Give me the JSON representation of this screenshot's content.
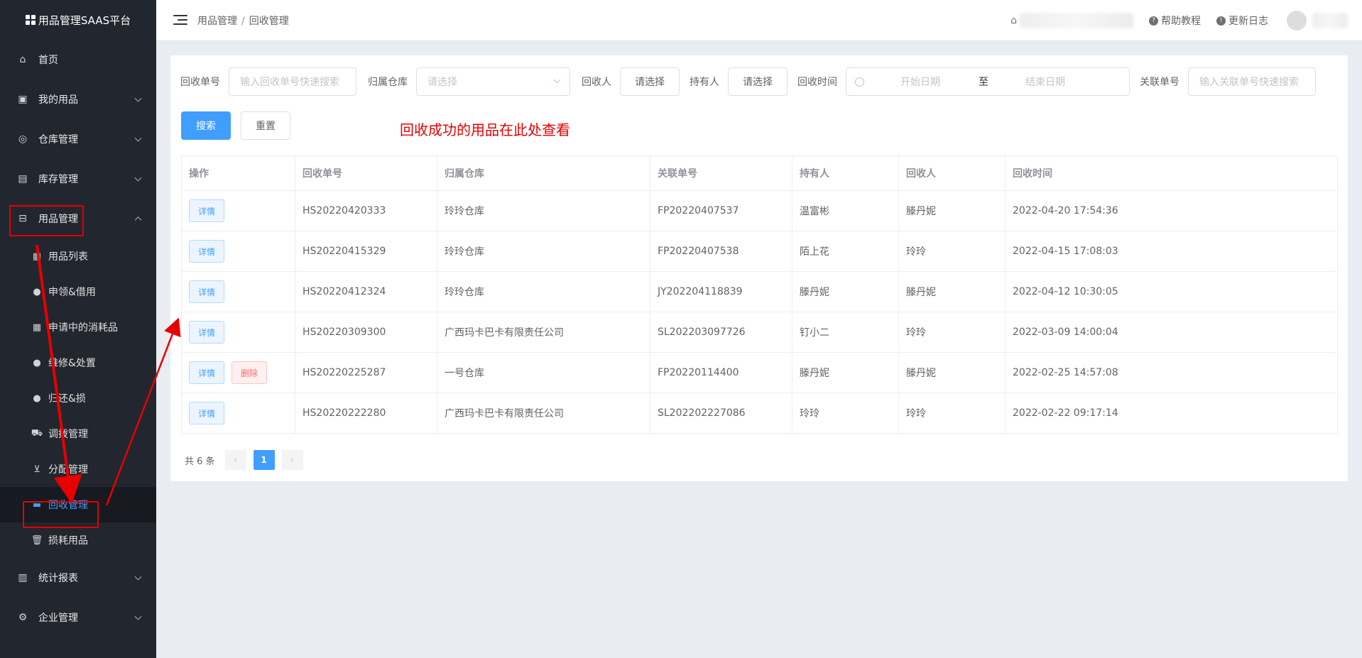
{
  "app": {
    "title": "用品管理SAAS平台"
  },
  "sidebar": {
    "items": [
      {
        "label": "首页",
        "icon": "home-icon"
      },
      {
        "label": "我的用品",
        "icon": "bag-icon"
      },
      {
        "label": "仓库管理",
        "icon": "database-icon"
      },
      {
        "label": "库存管理",
        "icon": "briefcase-icon"
      },
      {
        "label": "用品管理",
        "icon": "inbox-icon"
      }
    ],
    "submenu": [
      {
        "label": "用品列表",
        "icon": "clipboard-icon"
      },
      {
        "label": "申领&借用",
        "icon": "user-icon"
      },
      {
        "label": "申请中的消耗品",
        "icon": "clipboard-icon"
      },
      {
        "label": "维修&处置",
        "icon": "user-icon"
      },
      {
        "label": "归还&损",
        "icon": "user-icon"
      },
      {
        "label": "调拨管理",
        "icon": "truck-icon"
      },
      {
        "label": "分配管理",
        "icon": "cart-icon"
      },
      {
        "label": "回收管理",
        "icon": "recycle-icon"
      },
      {
        "label": "损耗用品",
        "icon": "trash-icon"
      }
    ],
    "bottom": [
      {
        "label": "统计报表",
        "icon": "bar-chart-icon"
      },
      {
        "label": "企业管理",
        "icon": "gear-icon"
      }
    ]
  },
  "header": {
    "breadcrumb": [
      "用品管理",
      "回收管理"
    ],
    "help": "帮助教程",
    "changelog": "更新日志"
  },
  "filters": {
    "recycle_no_label": "回收单号",
    "recycle_no_placeholder": "输入回收单号快速搜索",
    "warehouse_label": "归属仓库",
    "warehouse_placeholder": "请选择",
    "recycler_label": "回收人",
    "recycler_btn": "请选择",
    "holder_label": "持有人",
    "holder_btn": "请选择",
    "time_label": "回收时间",
    "start_placeholder": "开始日期",
    "to": "至",
    "end_placeholder": "结束日期",
    "related_label": "关联单号",
    "related_placeholder": "输入关联单号快速搜索"
  },
  "actions": {
    "search": "搜索",
    "reset": "重置"
  },
  "hint": "回收成功的用品在此处查看",
  "table": {
    "headers": [
      "操作",
      "回收单号",
      "归属仓库",
      "关联单号",
      "持有人",
      "回收人",
      "回收时间"
    ],
    "detail_label": "详情",
    "delete_label": "删除",
    "rows": [
      {
        "no": "HS20220420333",
        "warehouse": "玲玲仓库",
        "related": "FP20220407537",
        "holder": "温富彬",
        "recycler": "滕丹妮",
        "time": "2022-04-20 17:54:36",
        "deletable": false
      },
      {
        "no": "HS20220415329",
        "warehouse": "玲玲仓库",
        "related": "FP20220407538",
        "holder": "陌上花",
        "recycler": "玲玲",
        "time": "2022-04-15 17:08:03",
        "deletable": false
      },
      {
        "no": "HS20220412324",
        "warehouse": "玲玲仓库",
        "related": "JY202204118839",
        "holder": "滕丹妮",
        "recycler": "滕丹妮",
        "time": "2022-04-12 10:30:05",
        "deletable": false
      },
      {
        "no": "HS20220309300",
        "warehouse": "广西玛卡巴卡有限责任公司",
        "related": "SL202203097726",
        "holder": "钉小二",
        "recycler": "玲玲",
        "time": "2022-03-09 14:00:04",
        "deletable": false
      },
      {
        "no": "HS20220225287",
        "warehouse": "一号仓库",
        "related": "FP20220114400",
        "holder": "滕丹妮",
        "recycler": "滕丹妮",
        "time": "2022-02-25 14:57:08",
        "deletable": true
      },
      {
        "no": "HS20220222280",
        "warehouse": "广西玛卡巴卡有限责任公司",
        "related": "SL202202227086",
        "holder": "玲玲",
        "recycler": "玲玲",
        "time": "2022-02-22 09:17:14",
        "deletable": false
      }
    ]
  },
  "pagination": {
    "total_text": "共 6 条",
    "current": "1",
    "prev": "‹",
    "next": "›"
  },
  "colors": {
    "primary": "#409eff",
    "sidebar": "#22262e",
    "annotation": "#e60000"
  }
}
